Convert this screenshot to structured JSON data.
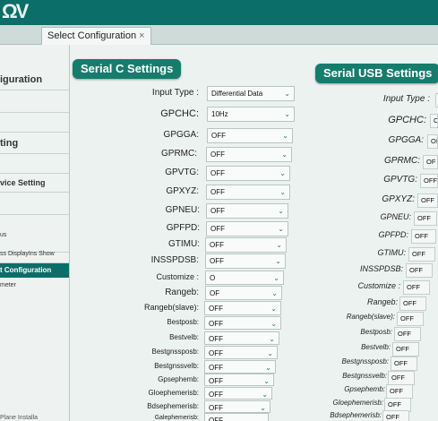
{
  "tabs": [
    {
      "label": "Select Configuration",
      "close": "×"
    }
  ],
  "sidebar": {
    "items": [
      {
        "label": "iguration"
      },
      {
        "label": "ting"
      },
      {
        "label": "vice Setting"
      },
      {
        "label": "us"
      },
      {
        "label": "ss DisplayIns Show"
      },
      {
        "label": "t Configuration"
      },
      {
        "label": "meter"
      },
      {
        "label": "Plane Installa"
      }
    ]
  },
  "serial_c": {
    "title": "Serial C Settings",
    "fields": [
      {
        "label": "Input Type :",
        "value": "Differential Data"
      },
      {
        "label": "GPCHC:",
        "value": "10Hz"
      },
      {
        "label": "GPGGA:",
        "value": "OFF"
      },
      {
        "label": "GPRMC:",
        "value": "OFF"
      },
      {
        "label": "GPVTG:",
        "value": "OFF"
      },
      {
        "label": "GPXYZ:",
        "value": "OFF"
      },
      {
        "label": "GPNEU:",
        "value": "OFF"
      },
      {
        "label": "GPFPD:",
        "value": "OFF"
      },
      {
        "label": "GTIMU:",
        "value": "OFF"
      },
      {
        "label": "INSSPDSB:",
        "value": "OFF"
      },
      {
        "label": "Customize :",
        "value": "O"
      },
      {
        "label": "Rangeb:",
        "value": "OF"
      },
      {
        "label": "Rangeb(slave):",
        "value": "OFF"
      },
      {
        "label": "Bestposb:",
        "value": "OFF"
      },
      {
        "label": "Bestvelb:",
        "value": "OFF"
      },
      {
        "label": "Bestgnssposb:",
        "value": "OFF"
      },
      {
        "label": "Bestgnssvelb:",
        "value": "OFF"
      },
      {
        "label": "Gpsephemb:",
        "value": "OFF"
      },
      {
        "label": "Gloephemerisb:",
        "value": "OFF"
      },
      {
        "label": "Bdsephemerisb:",
        "value": "OFF"
      },
      {
        "label": "Galephemerisb:",
        "value": "OFF"
      }
    ]
  },
  "serial_usb": {
    "title": "Serial USB Settings",
    "fields": [
      {
        "label": "Input Type :",
        "value": ""
      },
      {
        "label": "GPCHC:",
        "value": "C"
      },
      {
        "label": "GPGGA:",
        "value": "OI"
      },
      {
        "label": "GPRMC:",
        "value": "OF"
      },
      {
        "label": "GPVTG:",
        "value": "OFF"
      },
      {
        "label": "GPXYZ:",
        "value": "OFF"
      },
      {
        "label": "GPNEU:",
        "value": "OFF"
      },
      {
        "label": "GPFPD:",
        "value": "OFF"
      },
      {
        "label": "GTIMU:",
        "value": "OFF"
      },
      {
        "label": "INSSPDSB:",
        "value": "OFF"
      },
      {
        "label": "Customize :",
        "value": "OFF"
      },
      {
        "label": "Rangeb:",
        "value": "OFF"
      },
      {
        "label": "Rangeb(slave):",
        "value": "OFF"
      },
      {
        "label": "Bestposb:",
        "value": "OFF"
      },
      {
        "label": "Bestvelb:",
        "value": "OFF"
      },
      {
        "label": "Bestgnssposb:",
        "value": "OFF"
      },
      {
        "label": "Bestgnssvelb:",
        "value": "OFF"
      },
      {
        "label": "Gpsephemb:",
        "value": "OFF"
      },
      {
        "label": "Gloephemerisb:",
        "value": "OFF"
      },
      {
        "label": "Bdsephemerisb:",
        "value": "OFF"
      }
    ]
  },
  "colors": {
    "accent": "#167c6c",
    "topbar": "#0b6e68"
  }
}
